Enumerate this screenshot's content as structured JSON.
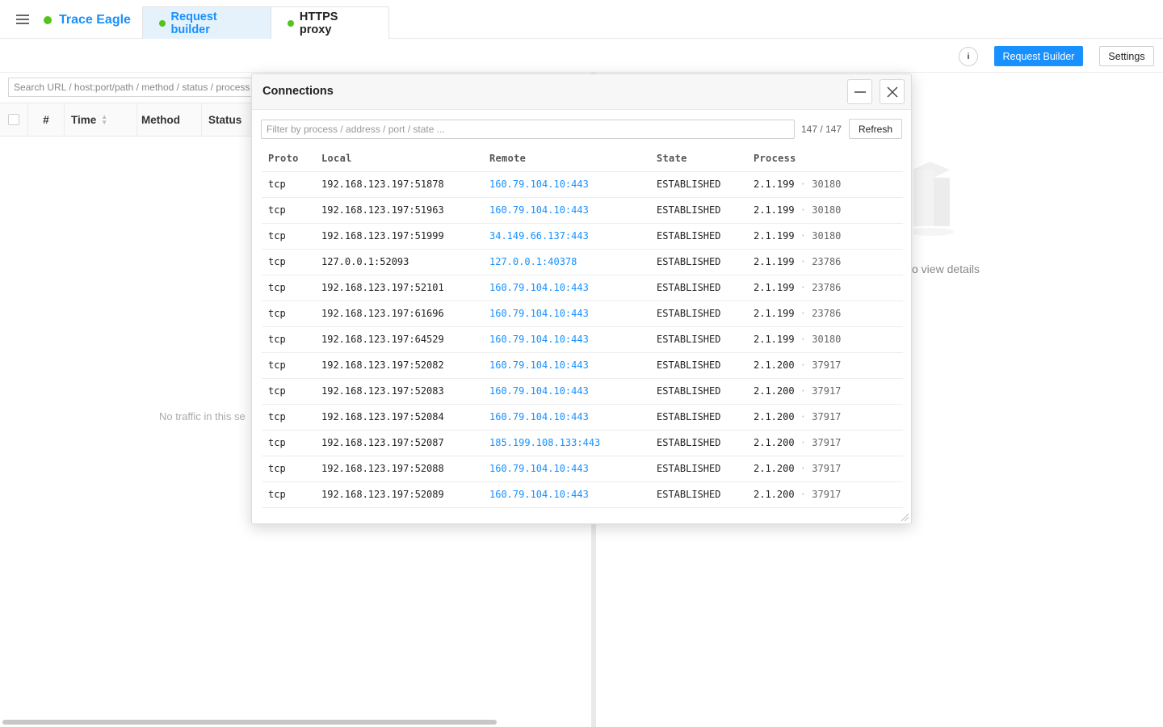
{
  "app": {
    "name": "Trace Eagle",
    "tabs": [
      {
        "label": "Request builder",
        "active": true
      },
      {
        "label": "HTTPS proxy",
        "active": false
      }
    ]
  },
  "toolbar": {
    "info_label": "i",
    "request_builder_label": "Request Builder",
    "settings_label": "Settings"
  },
  "traffic": {
    "search_placeholder": "Search URL / host:port/path / method / status / process",
    "columns": [
      "#",
      "Time",
      "Method",
      "Status"
    ],
    "empty_text": "No traffic in this se"
  },
  "details": {
    "empty_text": "o view details"
  },
  "modal": {
    "title": "Connections",
    "filter_placeholder": "Filter by process / address / port / state ...",
    "count": "147 / 147",
    "refresh_label": "Refresh",
    "columns": {
      "proto": "Proto",
      "local": "Local",
      "remote": "Remote",
      "state": "State",
      "process": "Process"
    },
    "rows": [
      {
        "proto": "tcp",
        "local": "192.168.123.197:51878",
        "remote": "160.79.104.10:443",
        "state": "ESTABLISHED",
        "process": "2.1.199",
        "pid": "30180"
      },
      {
        "proto": "tcp",
        "local": "192.168.123.197:51963",
        "remote": "160.79.104.10:443",
        "state": "ESTABLISHED",
        "process": "2.1.199",
        "pid": "30180"
      },
      {
        "proto": "tcp",
        "local": "192.168.123.197:51999",
        "remote": "34.149.66.137:443",
        "state": "ESTABLISHED",
        "process": "2.1.199",
        "pid": "30180"
      },
      {
        "proto": "tcp",
        "local": "127.0.0.1:52093",
        "remote": "127.0.0.1:40378",
        "state": "ESTABLISHED",
        "process": "2.1.199",
        "pid": "23786"
      },
      {
        "proto": "tcp",
        "local": "192.168.123.197:52101",
        "remote": "160.79.104.10:443",
        "state": "ESTABLISHED",
        "process": "2.1.199",
        "pid": "23786"
      },
      {
        "proto": "tcp",
        "local": "192.168.123.197:61696",
        "remote": "160.79.104.10:443",
        "state": "ESTABLISHED",
        "process": "2.1.199",
        "pid": "23786"
      },
      {
        "proto": "tcp",
        "local": "192.168.123.197:64529",
        "remote": "160.79.104.10:443",
        "state": "ESTABLISHED",
        "process": "2.1.199",
        "pid": "30180"
      },
      {
        "proto": "tcp",
        "local": "192.168.123.197:52082",
        "remote": "160.79.104.10:443",
        "state": "ESTABLISHED",
        "process": "2.1.200",
        "pid": "37917"
      },
      {
        "proto": "tcp",
        "local": "192.168.123.197:52083",
        "remote": "160.79.104.10:443",
        "state": "ESTABLISHED",
        "process": "2.1.200",
        "pid": "37917"
      },
      {
        "proto": "tcp",
        "local": "192.168.123.197:52084",
        "remote": "160.79.104.10:443",
        "state": "ESTABLISHED",
        "process": "2.1.200",
        "pid": "37917"
      },
      {
        "proto": "tcp",
        "local": "192.168.123.197:52087",
        "remote": "185.199.108.133:443",
        "state": "ESTABLISHED",
        "process": "2.1.200",
        "pid": "37917"
      },
      {
        "proto": "tcp",
        "local": "192.168.123.197:52088",
        "remote": "160.79.104.10:443",
        "state": "ESTABLISHED",
        "process": "2.1.200",
        "pid": "37917"
      },
      {
        "proto": "tcp",
        "local": "192.168.123.197:52089",
        "remote": "160.79.104.10:443",
        "state": "ESTABLISHED",
        "process": "2.1.200",
        "pid": "37917"
      }
    ]
  },
  "colors": {
    "accent": "#1890ff",
    "status_dot": "#52c41a"
  },
  "icons": {
    "menu": "hamburger-menu-icon",
    "minimize": "minimize-icon",
    "close": "close-icon",
    "sort": "sort-icon",
    "empty": "empty-box-icon"
  }
}
